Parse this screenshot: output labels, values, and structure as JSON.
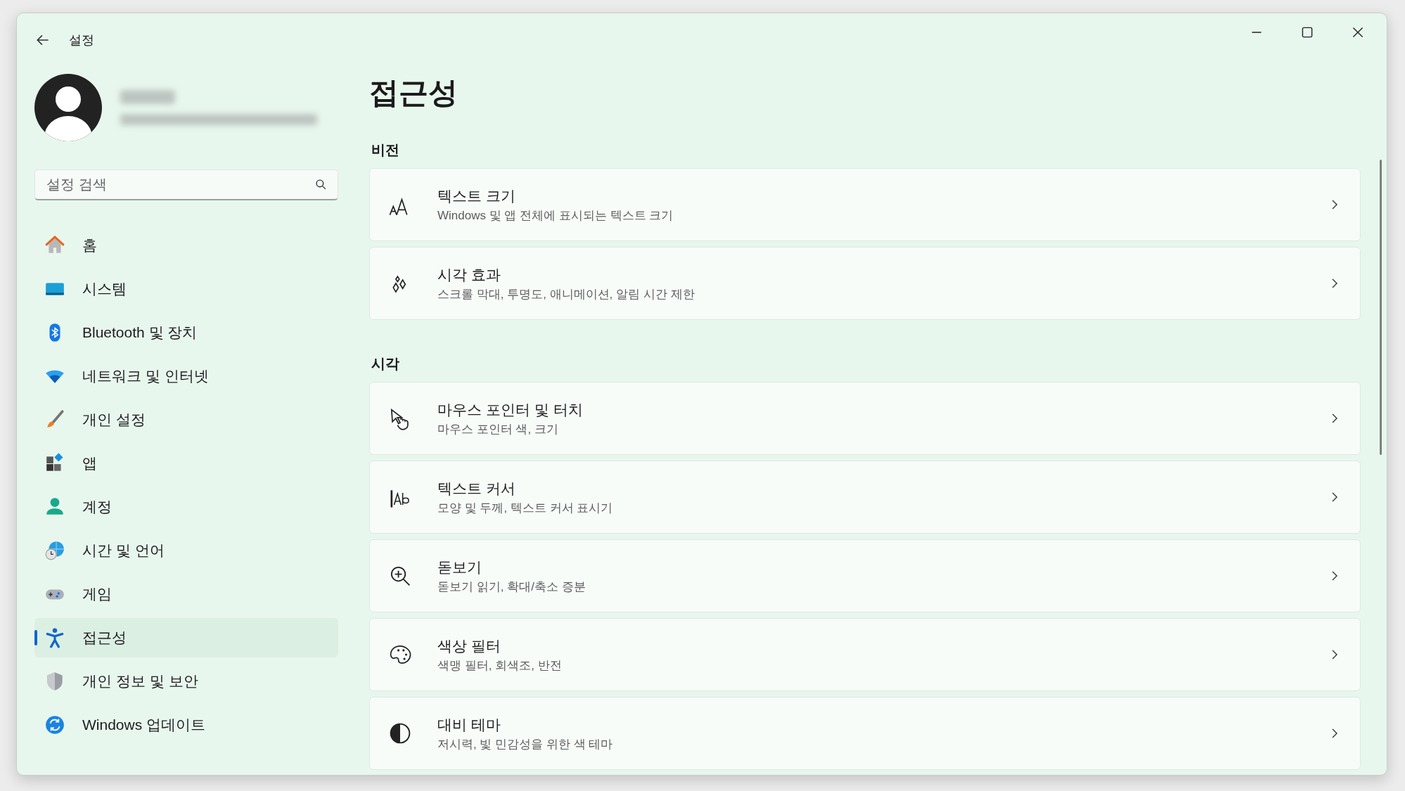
{
  "window": {
    "title": "설정"
  },
  "sidebar": {
    "search": {
      "placeholder": "설정 검색"
    },
    "items": [
      {
        "label": "홈",
        "selected": false
      },
      {
        "label": "시스템",
        "selected": false
      },
      {
        "label": "Bluetooth 및 장치",
        "selected": false
      },
      {
        "label": "네트워크 및 인터넷",
        "selected": false
      },
      {
        "label": "개인 설정",
        "selected": false
      },
      {
        "label": "앱",
        "selected": false
      },
      {
        "label": "계정",
        "selected": false
      },
      {
        "label": "시간 및 언어",
        "selected": false
      },
      {
        "label": "게임",
        "selected": false
      },
      {
        "label": "접근성",
        "selected": true
      },
      {
        "label": "개인 정보 및 보안",
        "selected": false
      },
      {
        "label": "Windows 업데이트",
        "selected": false
      }
    ]
  },
  "page": {
    "title": "접근성",
    "sections": [
      {
        "heading": "비전",
        "items": [
          {
            "title": "텍스트 크기",
            "subtitle": "Windows 및 앱 전체에 표시되는 텍스트 크기"
          },
          {
            "title": "시각 효과",
            "subtitle": "스크롤 막대, 투명도, 애니메이션, 알림 시간 제한"
          }
        ]
      },
      {
        "heading": "시각",
        "items": [
          {
            "title": "마우스 포인터 및 터치",
            "subtitle": "마우스 포인터 색, 크기"
          },
          {
            "title": "텍스트 커서",
            "subtitle": "모양 및 두께, 텍스트 커서 표시기"
          },
          {
            "title": "돋보기",
            "subtitle": "돋보기 읽기, 확대/축소 증분"
          },
          {
            "title": "색상 필터",
            "subtitle": "색맹 필터, 회색조, 반전"
          },
          {
            "title": "대비 테마",
            "subtitle": "저시력, 빛 민감성을 위한 색 테마"
          }
        ]
      }
    ]
  }
}
